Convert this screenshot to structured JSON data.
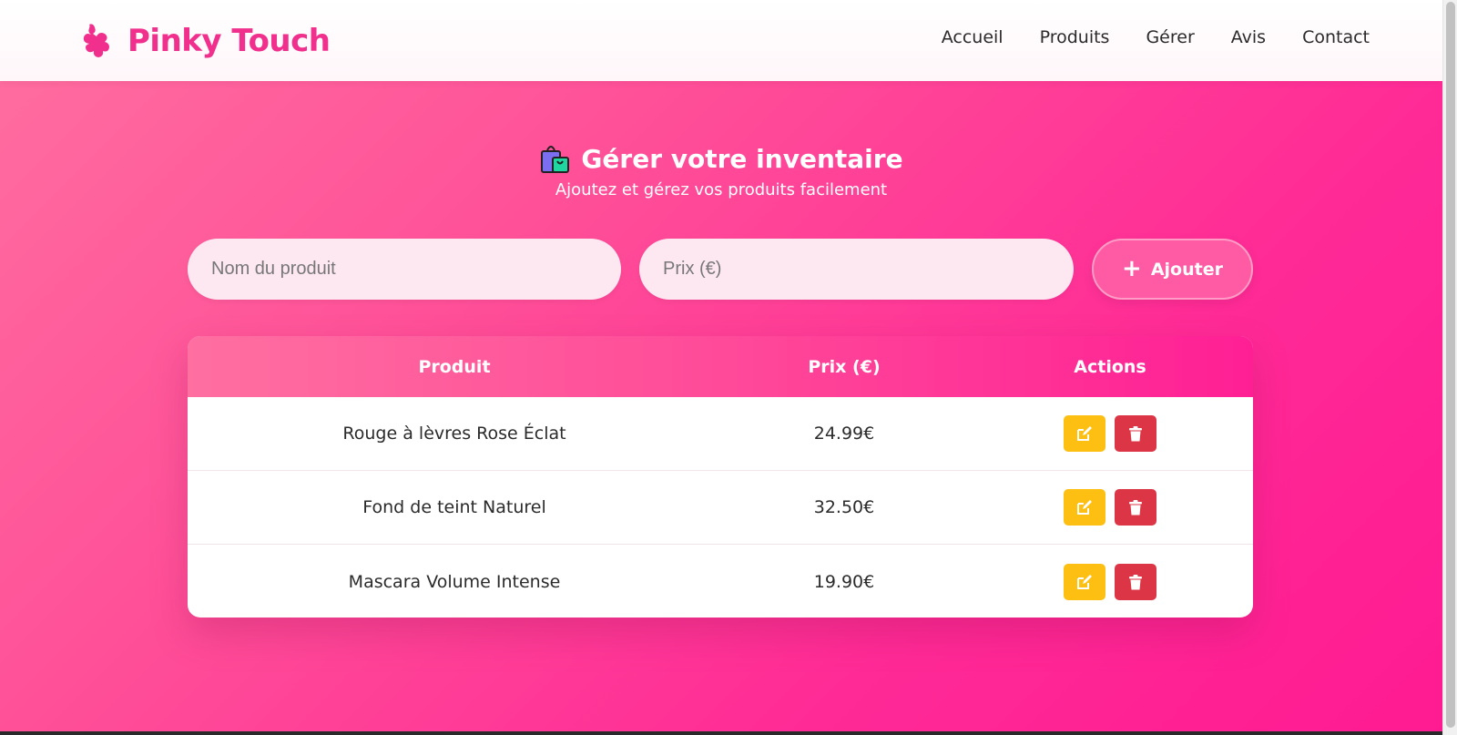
{
  "header": {
    "brand": "Pinky Touch",
    "brand_icon": "puzzle-splash-icon",
    "nav": [
      "Accueil",
      "Produits",
      "Gérer",
      "Avis",
      "Contact"
    ]
  },
  "hero": {
    "icon": "shopping-bags-icon",
    "title": "Gérer votre inventaire",
    "subtitle": "Ajoutez et gérez vos produits facilement"
  },
  "form": {
    "name_placeholder": "Nom du produit",
    "name_value": "",
    "price_placeholder": "Prix (€)",
    "price_value": "",
    "add_label": "Ajouter"
  },
  "table": {
    "headers": [
      "Produit",
      "Prix (€)",
      "Actions"
    ],
    "rows": [
      {
        "product": "Rouge à lèvres Rose Éclat",
        "price": "24.99€"
      },
      {
        "product": "Fond de teint Naturel",
        "price": "32.50€"
      },
      {
        "product": "Mascara Volume Intense",
        "price": "19.90€"
      }
    ]
  },
  "colors": {
    "brand": "#f0308c",
    "gradient_start": "#ff6fa0",
    "gradient_end": "#ff1a92",
    "edit_button": "#fdbf12",
    "delete_button": "#dc3545"
  }
}
